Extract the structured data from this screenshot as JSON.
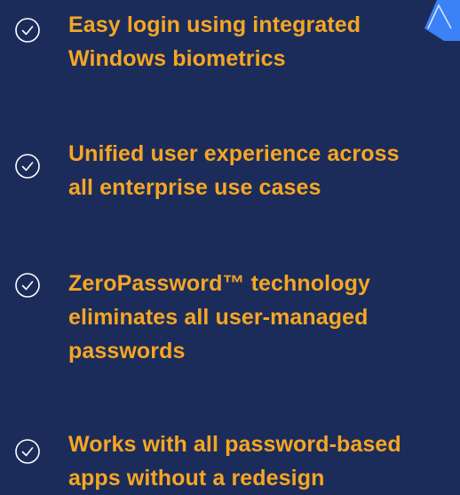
{
  "features": [
    {
      "text": "Easy login using integrated\nWindows biometrics",
      "icon": "check-circle-icon"
    },
    {
      "text": "Unified user experience across\nall enterprise use cases",
      "icon": "check-circle-icon"
    },
    {
      "text": "ZeroPassword™ technology\neliminates all user-managed\npasswords",
      "icon": "check-circle-icon"
    },
    {
      "text": "Works with all password-based\napps without a redesign",
      "icon": "check-circle-icon"
    }
  ],
  "colors": {
    "background": "#1c2c5a",
    "text": "#f5a623",
    "icon": "#ffffff",
    "accent": "#3b82f6"
  }
}
